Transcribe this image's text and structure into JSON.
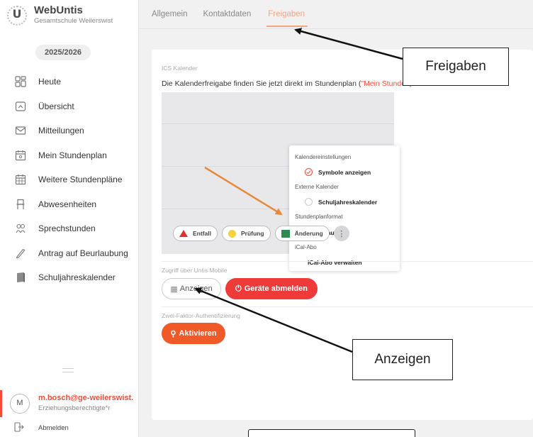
{
  "app": {
    "name": "WebUntis",
    "school": "Gesamtschule Weilerswist",
    "logo_letter": "U",
    "school_year": "2025/2026"
  },
  "sidebar": {
    "items": [
      {
        "label": "Heute",
        "icon": "dashboard-icon"
      },
      {
        "label": "Übersicht",
        "icon": "overview-icon"
      },
      {
        "label": "Mitteilungen",
        "icon": "mail-icon"
      },
      {
        "label": "Mein Stundenplan",
        "icon": "calendar-person-icon"
      },
      {
        "label": "Weitere Stundenpläne",
        "icon": "calendar-grid-icon"
      },
      {
        "label": "Abwesenheiten",
        "icon": "chair-icon"
      },
      {
        "label": "Sprechstunden",
        "icon": "people-icon"
      },
      {
        "label": "Antrag auf Beurlaubung",
        "icon": "pen-icon"
      },
      {
        "label": "Schuljahreskalender",
        "icon": "book-icon"
      }
    ],
    "user": {
      "avatar": "M",
      "name": "m.bosch@ge-weilerswist.",
      "role": "Erziehungsberechtigte*r"
    },
    "logout_label": "Abmelden"
  },
  "tabs": [
    {
      "label": "Allgemein",
      "active": false
    },
    {
      "label": "Kontaktdaten",
      "active": false
    },
    {
      "label": "Freigaben",
      "active": true
    }
  ],
  "ics": {
    "section_label": "ICS Kalender",
    "description": "Die Kalenderfreigabe finden Sie jetzt direkt im Stundenplan (",
    "link_text": "\"Mein Stundenpl",
    "popup": {
      "h1": "Kalendereinstellungen",
      "opt1": "Symbole anzeigen",
      "h2": "Externe Kalender",
      "opt2": "Schuljahreskalender",
      "h3": "Stundenplanformat",
      "opt3": "default",
      "h4": "iCal-Abo",
      "link": "iCal-Abo verwalten"
    },
    "legend": [
      "Entfall",
      "Prüfung",
      "Änderung"
    ],
    "more": "⋮"
  },
  "mobile": {
    "section_label": "Zugriff über Untis Mobile",
    "show_label": "Anzeigen",
    "show_icon": "▦",
    "logout_devices_label": "Geräte abmelden",
    "logout_devices_icon": "⏻"
  },
  "twofa": {
    "section_label": "Zwei-Faktor-Authentifizierung",
    "activate_label": "Aktivieren",
    "activate_icon": "⚲"
  },
  "callouts": {
    "freigaben": "Freigaben",
    "anzeigen": "Anzeigen"
  },
  "colors": {
    "accent_red": "#f04e37",
    "tab_active": "#f5a584",
    "arrow_orange": "#e8893a",
    "button_red": "#ef3a3a",
    "button_orange": "#f05a28"
  }
}
